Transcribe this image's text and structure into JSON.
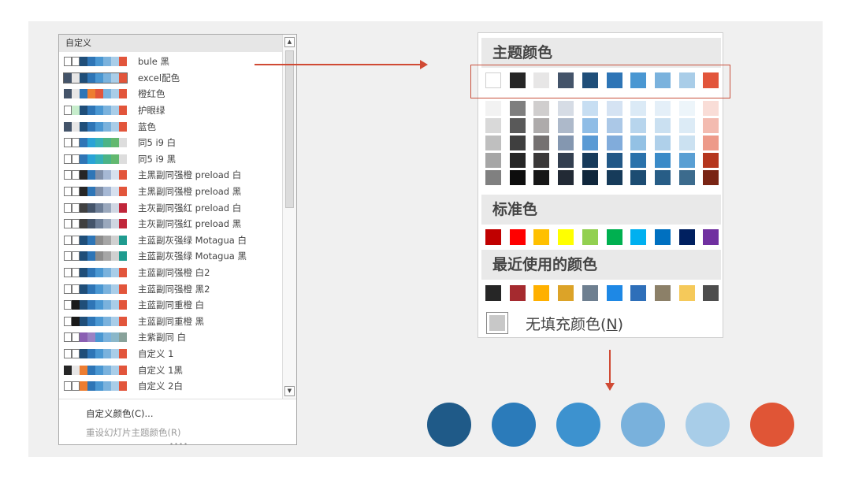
{
  "theme_panel": {
    "header": "自定义",
    "themes": [
      {
        "label": "bule 黑",
        "colors": [
          "#ffffff",
          "#ffffff",
          "#1f4e79",
          "#2e75b6",
          "#4a97d2",
          "#7ab2dd",
          "#a9cde8",
          "#e2553b"
        ]
      },
      {
        "label": "excel配色",
        "selected": true,
        "colors": [
          "#44546a",
          "#e7e6e6",
          "#1f4e79",
          "#2e75b6",
          "#4a97d2",
          "#7ab2dd",
          "#a9cde8",
          "#e2553b"
        ]
      },
      {
        "label": "橙红色",
        "colors": [
          "#44546a",
          "#e7e6e6",
          "#2e75b6",
          "#ed7d31",
          "#e2553b",
          "#7ab2dd",
          "#a9cde8",
          "#e2553b"
        ]
      },
      {
        "label": "护眼绿",
        "colors": [
          "#ffffff",
          "#c7edcc",
          "#1f4e79",
          "#2e75b6",
          "#4a97d2",
          "#7ab2dd",
          "#a9cde8",
          "#e2553b"
        ]
      },
      {
        "label": "蓝色",
        "colors": [
          "#44546a",
          "#e7e6e6",
          "#1f4e79",
          "#2e75b6",
          "#4a97d2",
          "#7ab2dd",
          "#a9cde8",
          "#e2553b"
        ]
      },
      {
        "label": "同5 i9 白",
        "colors": [
          "#ffffff",
          "#ffffff",
          "#2e75b6",
          "#29a3d6",
          "#36b0b8",
          "#4bb487",
          "#62b86f",
          "#dddddd"
        ]
      },
      {
        "label": "同5 i9 黑",
        "colors": [
          "#ffffff",
          "#ffffff",
          "#2e75b6",
          "#29a3d6",
          "#36b0b8",
          "#4bb487",
          "#62b86f",
          "#dddddd"
        ]
      },
      {
        "label": "主黑副同强橙 preload 白",
        "colors": [
          "#ffffff",
          "#ffffff",
          "#262626",
          "#2e75b6",
          "#7f8fa9",
          "#a6b8d4",
          "#d6e0ee",
          "#e2553b"
        ]
      },
      {
        "label": "主黑副同强橙 preload 黑",
        "colors": [
          "#ffffff",
          "#ffffff",
          "#262626",
          "#2e75b6",
          "#7f8fa9",
          "#a6b8d4",
          "#d6e0ee",
          "#e2553b"
        ]
      },
      {
        "label": "主灰副同强红 preload 白",
        "colors": [
          "#ffffff",
          "#ffffff",
          "#404040",
          "#44546a",
          "#6d7e97",
          "#9aa8bd",
          "#cfd6e2",
          "#c0263a"
        ]
      },
      {
        "label": "主灰副同强红 preload 黑",
        "colors": [
          "#ffffff",
          "#ffffff",
          "#404040",
          "#44546a",
          "#6d7e97",
          "#9aa8bd",
          "#cfd6e2",
          "#c0263a"
        ]
      },
      {
        "label": "主蓝副灰强绿 Motagua 白",
        "colors": [
          "#ffffff",
          "#ffffff",
          "#1f4e79",
          "#2e75b6",
          "#8c8c8c",
          "#a6a6a6",
          "#d0d0d0",
          "#1f9b8f"
        ]
      },
      {
        "label": "主蓝副灰强绿 Motagua 黑",
        "colors": [
          "#ffffff",
          "#ffffff",
          "#1f4e79",
          "#2e75b6",
          "#8c8c8c",
          "#a6a6a6",
          "#d0d0d0",
          "#1f9b8f"
        ]
      },
      {
        "label": "主蓝副同强橙 白2",
        "colors": [
          "#ffffff",
          "#ffffff",
          "#1f4e79",
          "#2e75b6",
          "#4a97d2",
          "#7ab2dd",
          "#a9cde8",
          "#e2553b"
        ]
      },
      {
        "label": "主蓝副同强橙 黑2",
        "colors": [
          "#ffffff",
          "#ffffff",
          "#1f4e79",
          "#2e75b6",
          "#4a97d2",
          "#7ab2dd",
          "#a9cde8",
          "#e2553b"
        ]
      },
      {
        "label": "主蓝副同重橙 白",
        "colors": [
          "#ffffff",
          "#1a1a1a",
          "#1f4e79",
          "#2e75b6",
          "#4a97d2",
          "#7ab2dd",
          "#a9cde8",
          "#e2553b"
        ]
      },
      {
        "label": "主蓝副同重橙 黑",
        "colors": [
          "#ffffff",
          "#1a1a1a",
          "#1f4e79",
          "#2e75b6",
          "#4a97d2",
          "#7ab2dd",
          "#a9cde8",
          "#e2553b"
        ]
      },
      {
        "label": "主紫副同 白",
        "colors": [
          "#ffffff",
          "#ffffff",
          "#8a5fb3",
          "#9a82c4",
          "#4a97d2",
          "#7ab2dd",
          "#8ab7c9",
          "#88a29a"
        ]
      },
      {
        "label": "自定义 1",
        "colors": [
          "#ffffff",
          "#ffffff",
          "#1f4e79",
          "#2e75b6",
          "#4a97d2",
          "#7ab2dd",
          "#a9cde8",
          "#e2553b"
        ]
      },
      {
        "label": "自定义 1黑",
        "colors": [
          "#262626",
          "#e7e6e6",
          "#ed7d31",
          "#2e75b6",
          "#4a97d2",
          "#7ab2dd",
          "#a9cde8",
          "#e2553b"
        ]
      },
      {
        "label": "自定义 2白",
        "colors": [
          "#ffffff",
          "#ffffff",
          "#ed7d31",
          "#2e75b6",
          "#4a97d2",
          "#7ab2dd",
          "#a9cde8",
          "#e2553b"
        ]
      }
    ],
    "footer_custom": "自定义颜色(C)...",
    "footer_reset": "重设幻灯片主题颜色(R)",
    "grip": "∙∙∙∙"
  },
  "color_picker": {
    "theme_title": "主题颜色",
    "theme_colors": [
      "#ffffff",
      "#262626",
      "#e7e6e6",
      "#44546a",
      "#1f4e79",
      "#2e75b6",
      "#4a97d2",
      "#7ab2dd",
      "#a9cde8",
      "#e2553b"
    ],
    "shade_columns": [
      [
        "#f2f2f2",
        "#d9d9d9",
        "#bfbfbf",
        "#a6a6a6",
        "#808080"
      ],
      [
        "#7f7f7f",
        "#595959",
        "#3f3f3f",
        "#262626",
        "#0d0d0d"
      ],
      [
        "#d0cece",
        "#aeabab",
        "#757171",
        "#3a3838",
        "#161616"
      ],
      [
        "#d6dce5",
        "#adb9ca",
        "#8497b0",
        "#333f50",
        "#222a35"
      ],
      [
        "#c7def2",
        "#8fbde6",
        "#5a9ad4",
        "#173b5b",
        "#10273c"
      ],
      [
        "#d5e3f3",
        "#abc8e7",
        "#81acdb",
        "#225887",
        "#163b5a"
      ],
      [
        "#dbeaf6",
        "#b7d5ed",
        "#93c1e4",
        "#2a72ab",
        "#1c4c72"
      ],
      [
        "#e4eff8",
        "#cae0f1",
        "#afd0ea",
        "#3b8bc8",
        "#275d86"
      ],
      [
        "#edf5fa",
        "#dcebf6",
        "#cbe1f1",
        "#5a9fd3",
        "#3c6b8d"
      ],
      [
        "#f9ddd7",
        "#f3bbb0",
        "#ed9a89",
        "#b5361e",
        "#792414"
      ]
    ],
    "standard_title": "标准色",
    "standard_colors": [
      "#c00000",
      "#ff0000",
      "#ffc000",
      "#ffff00",
      "#92d050",
      "#00b050",
      "#00b0f0",
      "#0070c0",
      "#002060",
      "#7030a0"
    ],
    "recent_title": "最近使用的颜色",
    "recent_colors": [
      "#262626",
      "#a52a2f",
      "#ffb000",
      "#dca328",
      "#6e7f90",
      "#1e88e5",
      "#2e6fb9",
      "#8c8068",
      "#f5c95a",
      "#4d4d4d"
    ],
    "no_fill_text": "无填充颜色(",
    "no_fill_key": "N",
    "no_fill_close": ")"
  },
  "selected_palette": [
    "#1f5a88",
    "#2b7bba",
    "#3d92cf",
    "#79b1dc",
    "#a8cde8",
    "#e05536"
  ]
}
